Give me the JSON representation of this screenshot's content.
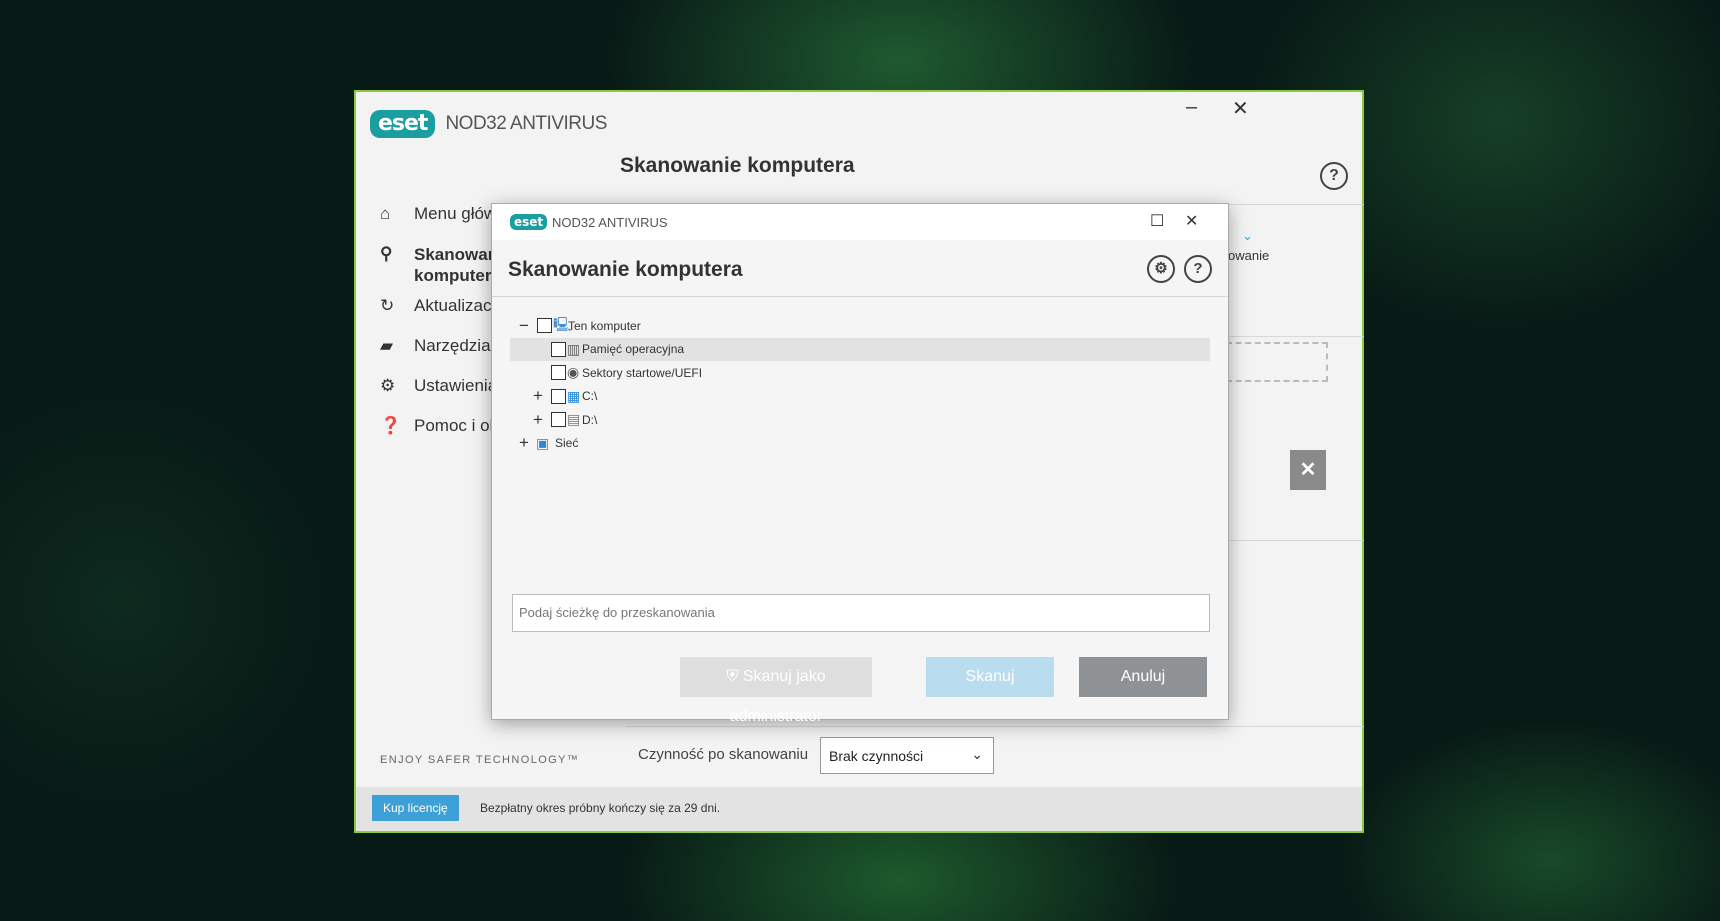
{
  "main_window": {
    "brand_logo": "eset",
    "brand_name": "NOD32 ANTIVIRUS",
    "minimize": "–",
    "close": "✕",
    "header_title": "Skanowanie komputera",
    "help": "?",
    "sidebar": {
      "items": [
        {
          "label": "Menu głów",
          "icon": "home-icon"
        },
        {
          "label": "Skanowan komputera",
          "icon": "search-icon"
        },
        {
          "label": "Aktualizac",
          "icon": "refresh-icon"
        },
        {
          "label": "Narzędzia",
          "icon": "toolbox-icon"
        },
        {
          "label": "Ustawienia",
          "icon": "gear-icon"
        },
        {
          "label": "Pomoc i ol",
          "icon": "question-icon"
        }
      ]
    },
    "right_fragment_text": "owanie",
    "right_close": "✕",
    "enjoy_text": "ENJOY SAFER TECHNOLOGY™",
    "post_scan_label": "Czynność po skanowaniu",
    "post_scan_value": "Brak czynności",
    "buy_label": "Kup licencję",
    "trial_text": "Bezpłatny okres próbny kończy się za 29 dni."
  },
  "dialog": {
    "logo": "eset",
    "brand_name": "NOD32 ANTIVIRUS",
    "title": "Skanowanie komputera",
    "tree": [
      {
        "label": "Ten komputer",
        "expander": "−",
        "level": 0,
        "icon": "computer-icon",
        "checkbox": true
      },
      {
        "label": "Pamięć operacyjna",
        "expander": "",
        "level": 1,
        "icon": "memory-icon",
        "checkbox": true,
        "highlighted": true
      },
      {
        "label": "Sektory startowe/UEFI",
        "expander": "",
        "level": 1,
        "icon": "disc-icon",
        "checkbox": true
      },
      {
        "label": "C:\\",
        "expander": "+",
        "level": 1,
        "icon": "windows-drive-icon",
        "checkbox": true
      },
      {
        "label": "D:\\",
        "expander": "+",
        "level": 1,
        "icon": "drive-icon",
        "checkbox": true
      },
      {
        "label": "Sieć",
        "expander": "+",
        "level": 0,
        "icon": "network-icon",
        "checkbox": false
      }
    ],
    "path_placeholder": "Podaj ścieżkę do przeskanowania",
    "btn_admin": "Skanuj jako administrator",
    "btn_scan": "Skanuj",
    "btn_cancel": "Anuluj"
  }
}
